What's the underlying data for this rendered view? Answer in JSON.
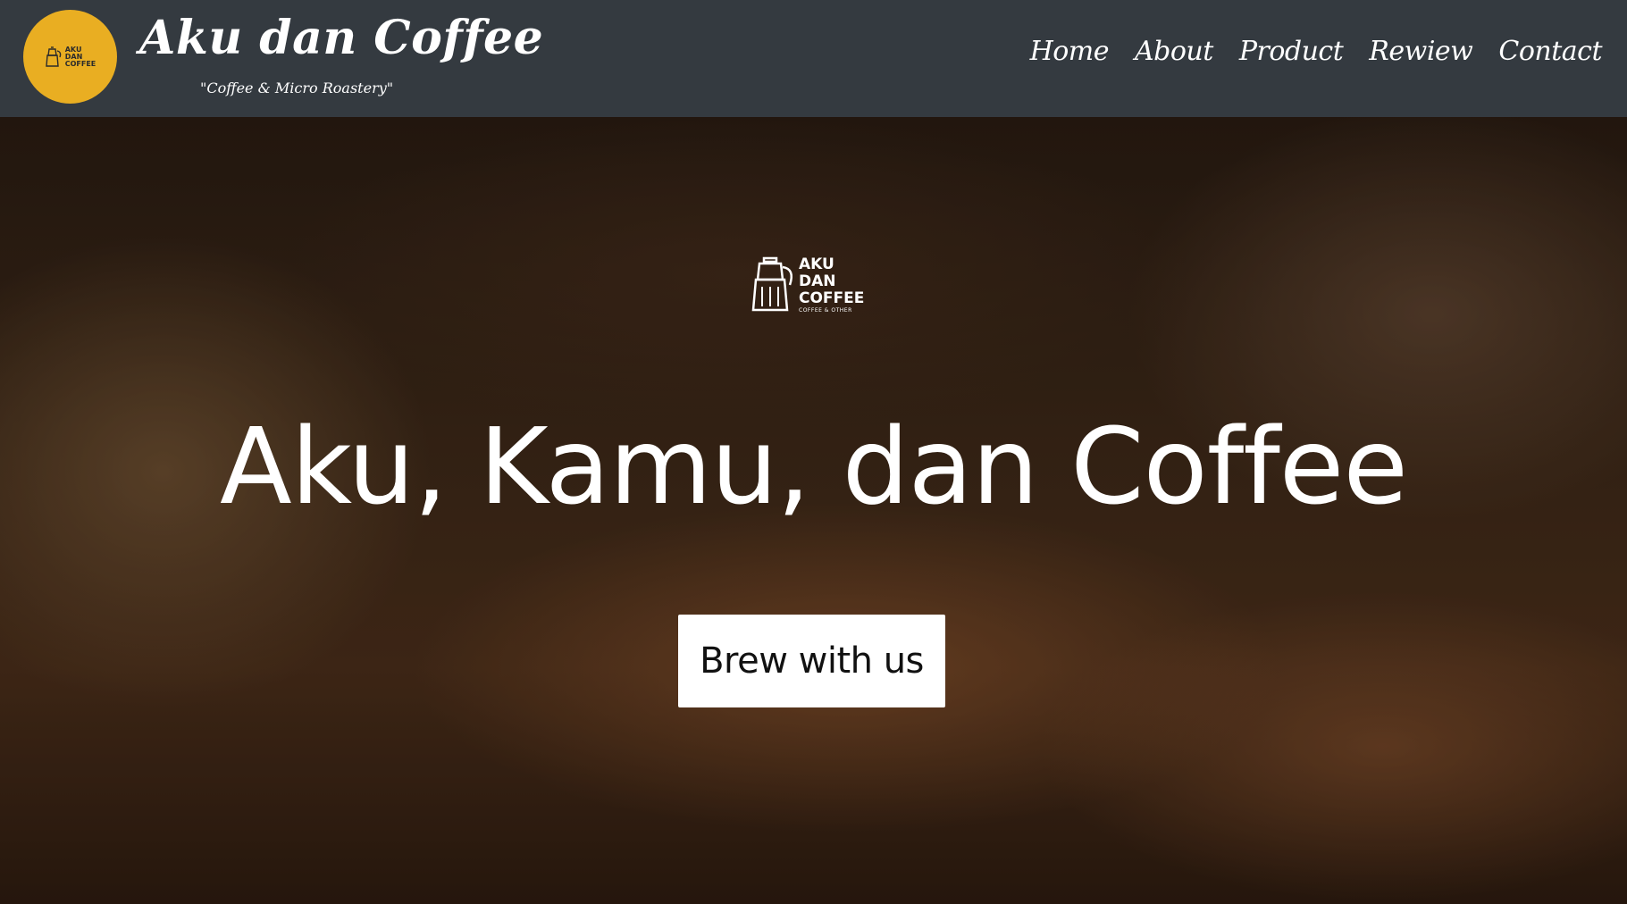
{
  "navbar": {
    "brand": {
      "logo": {
        "line1": "AKU",
        "line2": "DAN",
        "line3": "COFFEE",
        "icon": "moka-pot-icon"
      },
      "title": "Aku dan Coffee",
      "tagline": "\"Coffee & Micro Roastery\""
    },
    "links": [
      {
        "label": "Home"
      },
      {
        "label": "About"
      },
      {
        "label": "Product"
      },
      {
        "label": "Rewiew"
      },
      {
        "label": "Contact"
      }
    ]
  },
  "hero": {
    "logo": {
      "line1": "AKU",
      "line2": "DAN",
      "line3": "COFFEE",
      "sub": "COFFEE & OTHER",
      "icon": "moka-pot-icon"
    },
    "title": "Aku, Kamu, dan Coffee",
    "cta_label": "Brew with us"
  },
  "colors": {
    "navbar_bg": "#343a40",
    "brand_circle": "#e9ae22",
    "text_light": "#ffffff",
    "button_bg": "#ffffff",
    "button_text": "#111111"
  }
}
